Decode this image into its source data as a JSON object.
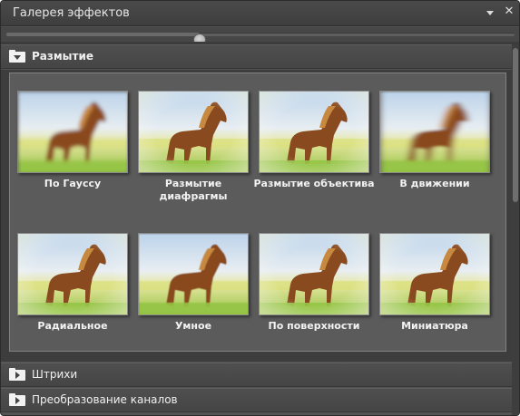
{
  "panel": {
    "title": "Галерея эффектов",
    "menu_icon": "chevron-down-icon",
    "close_icon": "close-icon",
    "close_glyph": "✕"
  },
  "zoom_slider": {
    "value_fraction": 0.38
  },
  "sections": [
    {
      "label": "Размытие",
      "expanded": true
    },
    {
      "label": "Штрихи",
      "expanded": false
    },
    {
      "label": "Преобразование каналов",
      "expanded": false
    }
  ],
  "effects": [
    {
      "label": "По Гауссу",
      "style": "gauss"
    },
    {
      "label": "Размытие диафрагмы",
      "style": "iris"
    },
    {
      "label": "Размытие объектива",
      "style": "lens"
    },
    {
      "label": "В движении",
      "style": "motion"
    },
    {
      "label": "Радиальное",
      "style": "radial"
    },
    {
      "label": "Умное",
      "style": "smart"
    },
    {
      "label": "По поверхности",
      "style": "surface"
    },
    {
      "label": "Миниатюра",
      "style": "tiltshift"
    }
  ],
  "colors": {
    "panel_bg": "#535353",
    "horse": "#8a4a1f",
    "sky": "#cfe0f0",
    "grass": "#a8c95a"
  }
}
